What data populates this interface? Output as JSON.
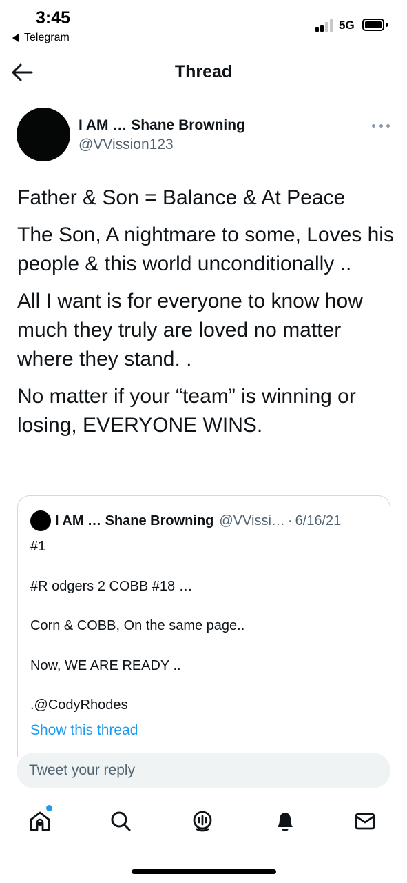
{
  "status_bar": {
    "time": "3:45",
    "back_app": "Telegram",
    "network": "5G",
    "signal_bars": 2,
    "battery_level": 1
  },
  "header": {
    "title": "Thread",
    "back_icon": "arrow-left-icon"
  },
  "tweet": {
    "author_name": "I AM … Shane Browning",
    "author_handle": "@VVission123",
    "paragraphs": [
      "Father & Son = Balance & At Peace",
      "The Son, A nightmare to some, Loves his people & this world unconditionally ..",
      "All I want is for everyone to know how much they truly are loved no matter where they stand. .",
      "No matter if your “team” is winning or losing, EVERYONE WINS."
    ]
  },
  "quoted_tweet": {
    "author_name": "I AM … Shane Browning",
    "author_handle": "@VVissi…",
    "separator": "·",
    "date": "6/16/21",
    "lines": [
      "#1",
      "#R odgers 2 COBB #18 …",
      "Corn & COBB, On the same page..",
      "Now, WE ARE READY ..",
      ".@CodyRhodes"
    ],
    "show_thread": "Show this thread"
  },
  "reply": {
    "placeholder": "Tweet your reply"
  },
  "tabbar": {
    "items": [
      "home-icon",
      "search-icon",
      "spaces-icon",
      "notifications-icon",
      "messages-icon"
    ],
    "accent": "#1d9bf0"
  }
}
